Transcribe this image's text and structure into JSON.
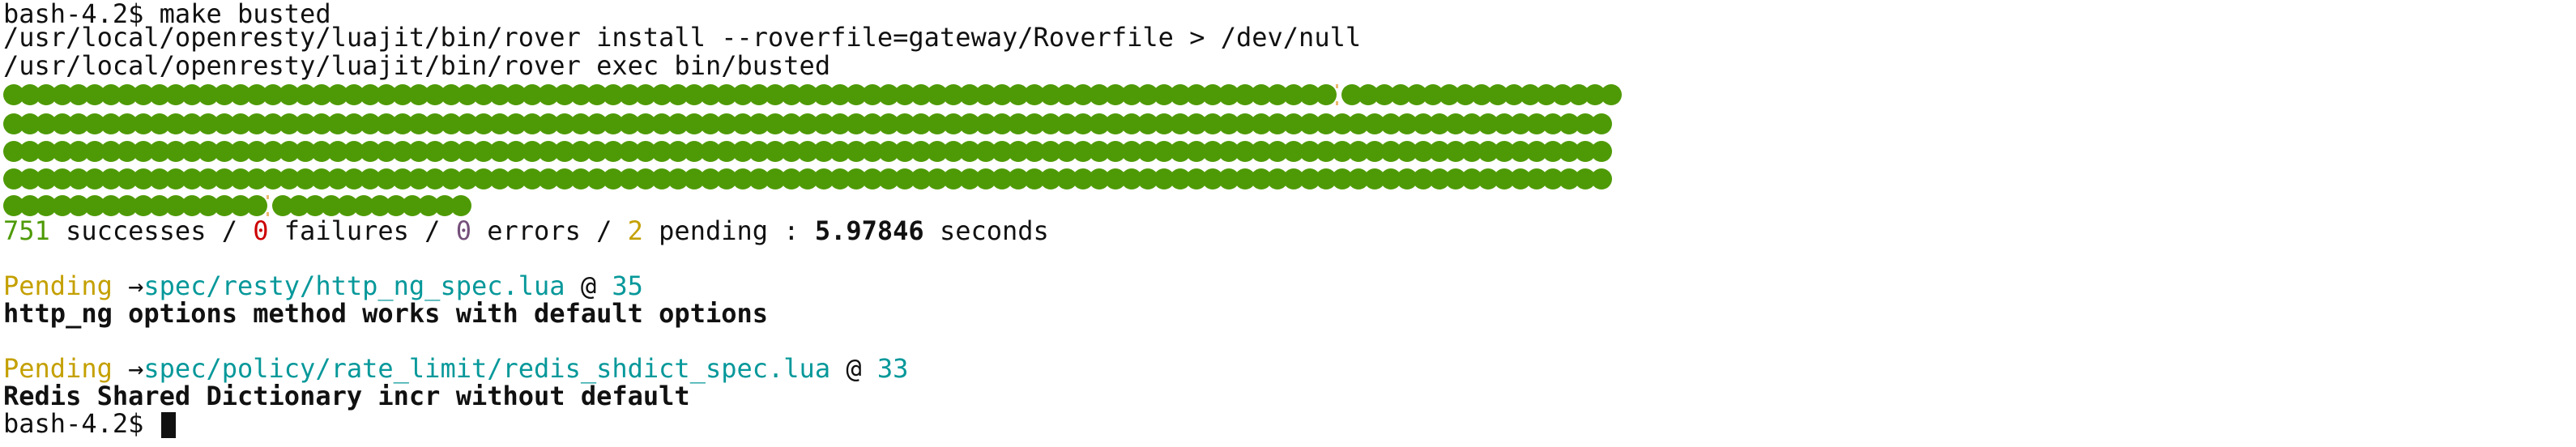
{
  "terminal": {
    "prompt": "bash-4.2$",
    "lines": [
      "make busted",
      "/usr/local/openresty/luajit/bin/rover install --roverfile=gateway/Roverfile > /dev/null",
      "/usr/local/openresty/luajit/bin/rover exec bin/busted"
    ]
  },
  "progress": {
    "dot_rows": [
      {
        "segments": [
          82,
          17
        ]
      },
      {
        "segments": [
          99
        ]
      },
      {
        "segments": [
          99
        ]
      },
      {
        "segments": [
          99
        ]
      },
      {
        "segments": [
          16,
          12
        ]
      }
    ],
    "colors": {
      "success": "#4e9a06",
      "pending_marker": "#e9b96e"
    }
  },
  "summary": {
    "successes_count": "751",
    "successes_label": " successes / ",
    "failures_count": "0",
    "failures_label": " failures / ",
    "errors_count": "0",
    "errors_label": " errors / ",
    "pending_count": "2",
    "pending_label": " pending : ",
    "seconds_value": "5.97846",
    "seconds_label": " seconds"
  },
  "pending_items": [
    {
      "label": "Pending",
      "arrow": " →",
      "file": "spec/resty/http_ng_spec.lua",
      "at": " @ ",
      "line": "35",
      "description": "http_ng options method works with default options"
    },
    {
      "label": "Pending",
      "arrow": " →",
      "file": "spec/policy/rate_limit/redis_shdict_spec.lua",
      "at": " @ ",
      "line": "33",
      "description": "Redis Shared Dictionary incr without default"
    }
  ]
}
